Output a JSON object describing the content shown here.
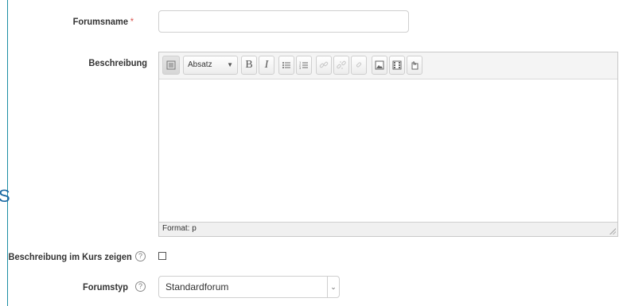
{
  "form": {
    "forumname": {
      "label": "Forumsname",
      "required_mark": "*",
      "value": ""
    },
    "description": {
      "label": "Beschreibung",
      "toolbar": {
        "toggle_icon": "toolbar-toggle-icon",
        "format_select": "Absatz",
        "bold": "B",
        "italic": "I",
        "unordered_list_icon": "unordered-list-icon",
        "ordered_list_icon": "ordered-list-icon",
        "link_icon": "link-icon",
        "unlink_icon": "unlink-icon",
        "anchor_icon": "anchor-icon",
        "image_icon": "image-icon",
        "media_icon": "media-icon",
        "file_icon": "file-icon"
      },
      "status": "Format: p"
    },
    "show_description": {
      "label": "Beschreibung im Kurs zeigen",
      "help": "?",
      "checked": false
    },
    "forum_type": {
      "label": "Forumstyp",
      "help": "?",
      "value": "Standardforum"
    }
  },
  "colors": {
    "frame": "#1c8ea3",
    "required": "#d9534f"
  },
  "edge_glyph": "S"
}
